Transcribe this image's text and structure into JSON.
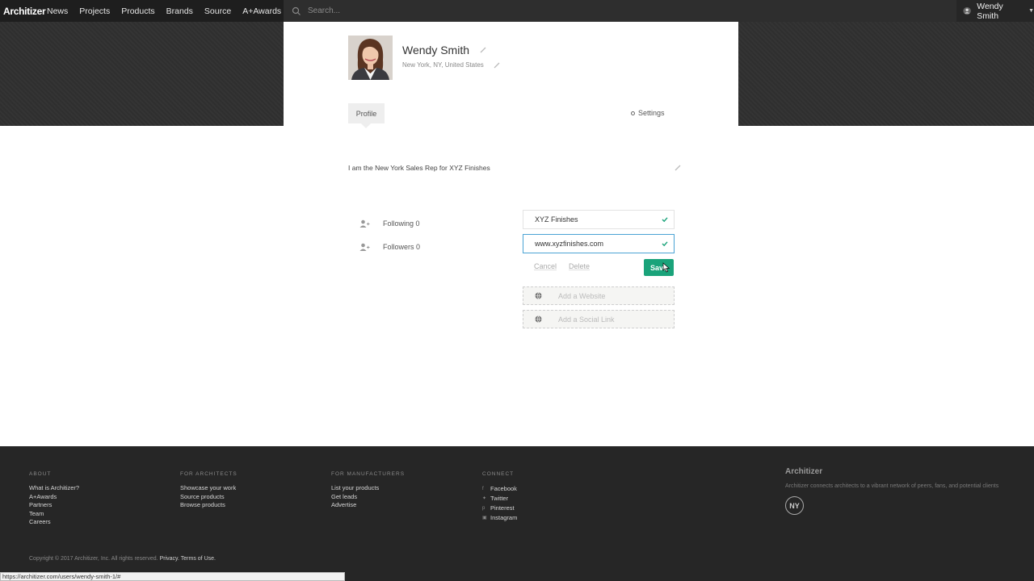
{
  "nav": {
    "logo": "Architizer",
    "links": [
      "News",
      "Projects",
      "Products",
      "Brands",
      "Source",
      "A+Awards"
    ],
    "search_placeholder": "Search...",
    "user_name": "Wendy Smith"
  },
  "profile": {
    "name": "Wendy Smith",
    "location": "New York, NY, United States",
    "tabs": {
      "profile": "Profile",
      "settings": "Settings"
    },
    "bio": "I am the New York Sales Rep for XYZ Finishes",
    "following": "Following 0",
    "followers": "Followers 0"
  },
  "company_form": {
    "company_value": "XYZ Finishes",
    "website_value": "www.xyzfinishes.com",
    "cancel_label": "Cancel",
    "delete_label": "Delete",
    "save_label": "Save",
    "add_website": "Add a Website",
    "add_social": "Add a Social Link"
  },
  "footer": {
    "about": {
      "heading": "ABOUT",
      "links": [
        "What is Architizer?",
        "A+Awards",
        "Partners",
        "Team",
        "Careers"
      ]
    },
    "architects": {
      "heading": "FOR ARCHITECTS",
      "links": [
        "Showcase your work",
        "Source products",
        "Browse products"
      ]
    },
    "manufacturers": {
      "heading": "FOR MANUFACTURERS",
      "links": [
        "List your products",
        "Get leads",
        "Advertise"
      ]
    },
    "connect": {
      "heading": "CONNECT",
      "links": [
        "Facebook",
        "Twitter",
        "Pinterest",
        "Instagram"
      ]
    },
    "brand": "Architizer",
    "tagline": "Architizer connects architects to a vibrant network of peers, fans, and potential clients",
    "badge": "NY",
    "copyright": "Copyright © 2017 Architizer, Inc. All rights reserved.",
    "privacy": "Privacy.",
    "terms": "Terms of Use."
  },
  "status_url": "https://architizer.com/users/wendy-smith-1/#",
  "colors": {
    "accent_green": "#1aa37a",
    "focus_blue": "#4aa3d4",
    "nav_bg": "#1e1e1e"
  }
}
